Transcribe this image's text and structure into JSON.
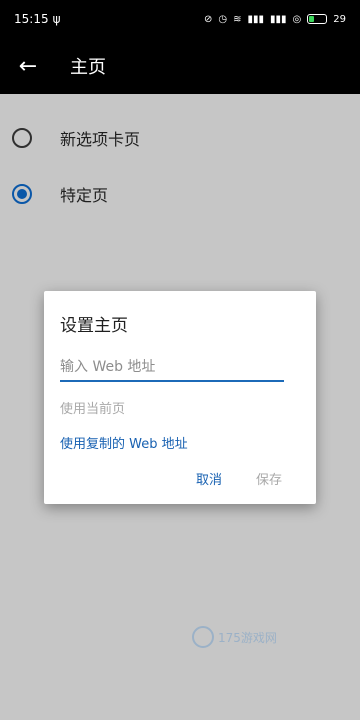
{
  "status_bar": {
    "time": "15:15",
    "battery": "29"
  },
  "app_bar": {
    "title": "主页"
  },
  "options": [
    {
      "label": "新选项卡页",
      "selected": false
    },
    {
      "label": "特定页",
      "selected": true
    }
  ],
  "dialog": {
    "title": "设置主页",
    "input_placeholder": "输入 Web 地址",
    "use_current": "使用当前页",
    "use_copied": "使用复制的 Web 地址",
    "cancel": "取消",
    "save": "保存"
  },
  "watermark": {
    "text": "175游戏网"
  }
}
